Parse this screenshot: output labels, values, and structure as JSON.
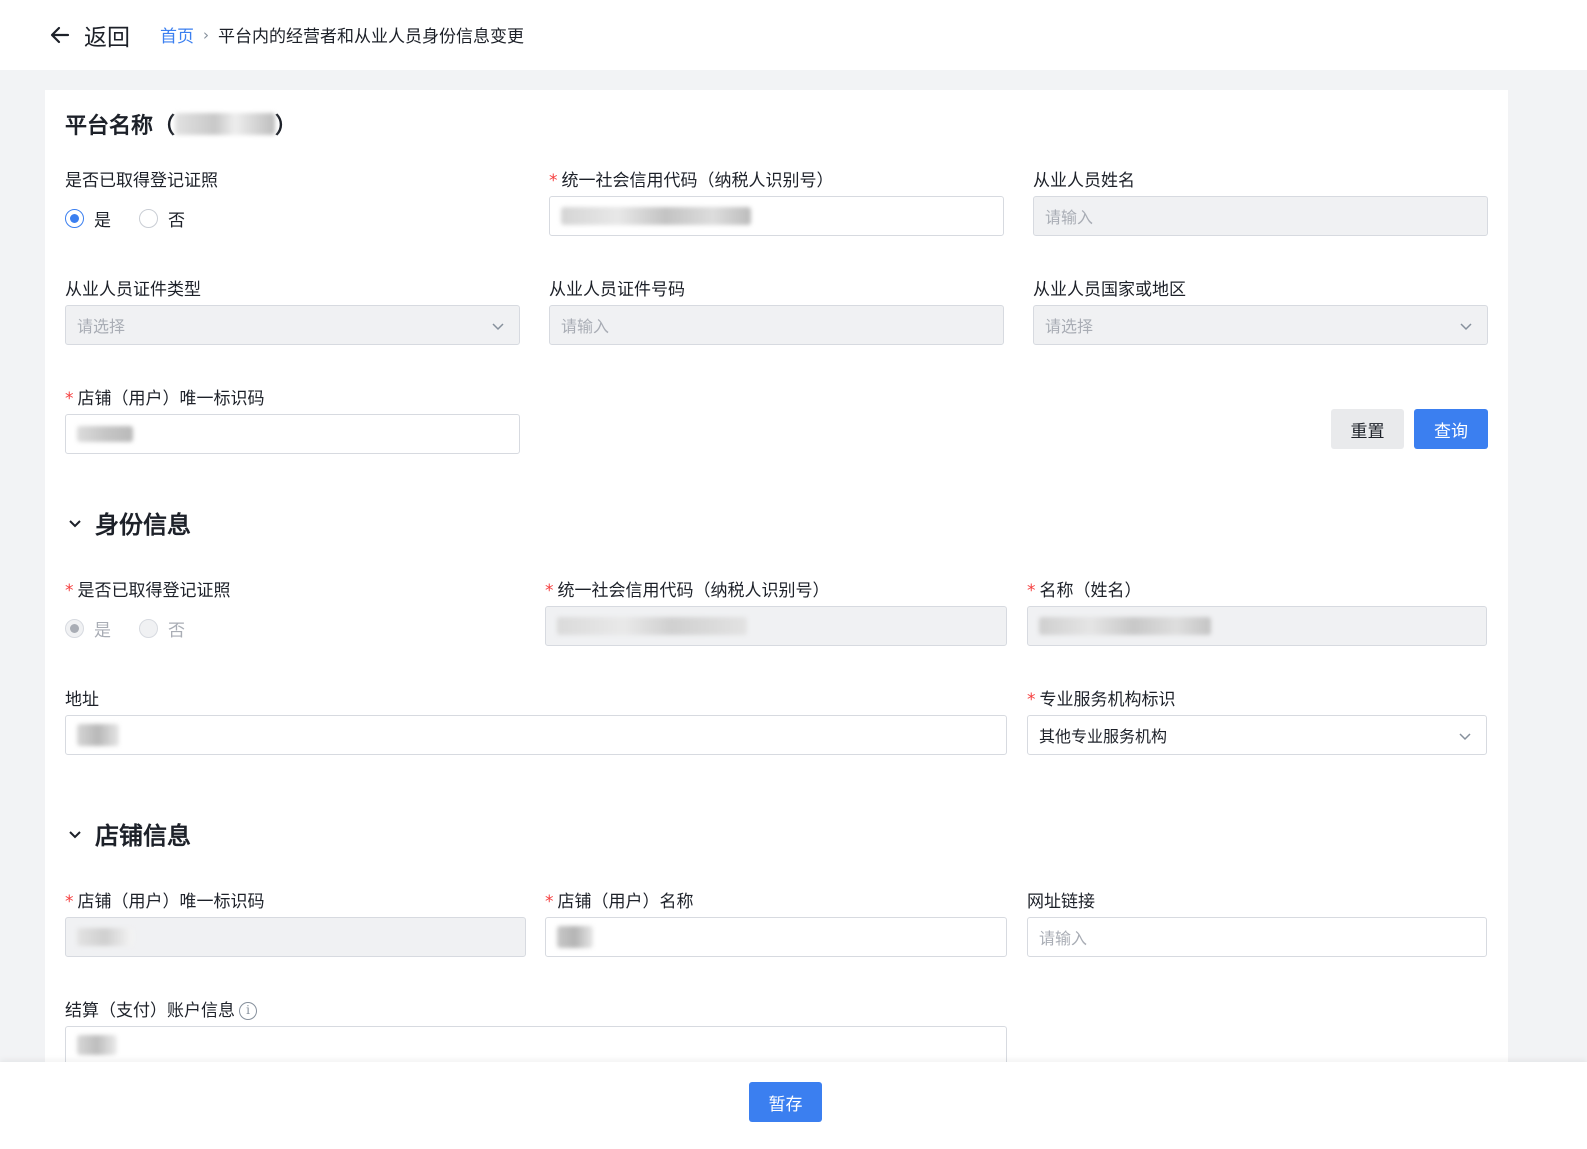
{
  "header": {
    "back_label": "返回",
    "breadcrumb_home": "首页",
    "breadcrumb_separator": "›",
    "breadcrumb_current": "平台内的经营者和从业人员身份信息变更"
  },
  "platform": {
    "title_prefix": "平台名称（",
    "title_suffix": "）"
  },
  "search": {
    "licensed_label": "是否已取得登记证照",
    "licensed_options": [
      "是",
      "否"
    ],
    "licensed_selected": "是",
    "credit_code_label": "统一社会信用代码（纳税人识别号）",
    "staff_name_label": "从业人员姓名",
    "staff_name_placeholder": "请输入",
    "id_type_label": "从业人员证件类型",
    "id_type_placeholder": "请选择",
    "id_number_label": "从业人员证件号码",
    "id_number_placeholder": "请输入",
    "country_label": "从业人员国家或地区",
    "country_placeholder": "请选择",
    "shop_id_label": "店铺（用户）唯一标识码",
    "reset_label": "重置",
    "query_label": "查询"
  },
  "identity": {
    "section_title": "身份信息",
    "licensed_label": "是否已取得登记证照",
    "licensed_options": [
      "是",
      "否"
    ],
    "licensed_selected": "是",
    "credit_code_label": "统一社会信用代码（纳税人识别号）",
    "name_label": "名称（姓名）",
    "address_label": "地址",
    "service_org_label": "专业服务机构标识",
    "service_org_value": "其他专业服务机构"
  },
  "shop": {
    "section_title": "店铺信息",
    "shop_id_label": "店铺（用户）唯一标识码",
    "shop_name_label": "店铺（用户）名称",
    "url_label": "网址链接",
    "url_placeholder": "请输入",
    "account_label": "结算（支付）账户信息",
    "info_icon_glyph": "i"
  },
  "footer": {
    "save_label": "暂存"
  },
  "colors": {
    "primary": "#3b7ff0",
    "required": "#f53f3f",
    "disabled_bg": "#f0f1f3",
    "page_bg": "#f2f3f5"
  }
}
